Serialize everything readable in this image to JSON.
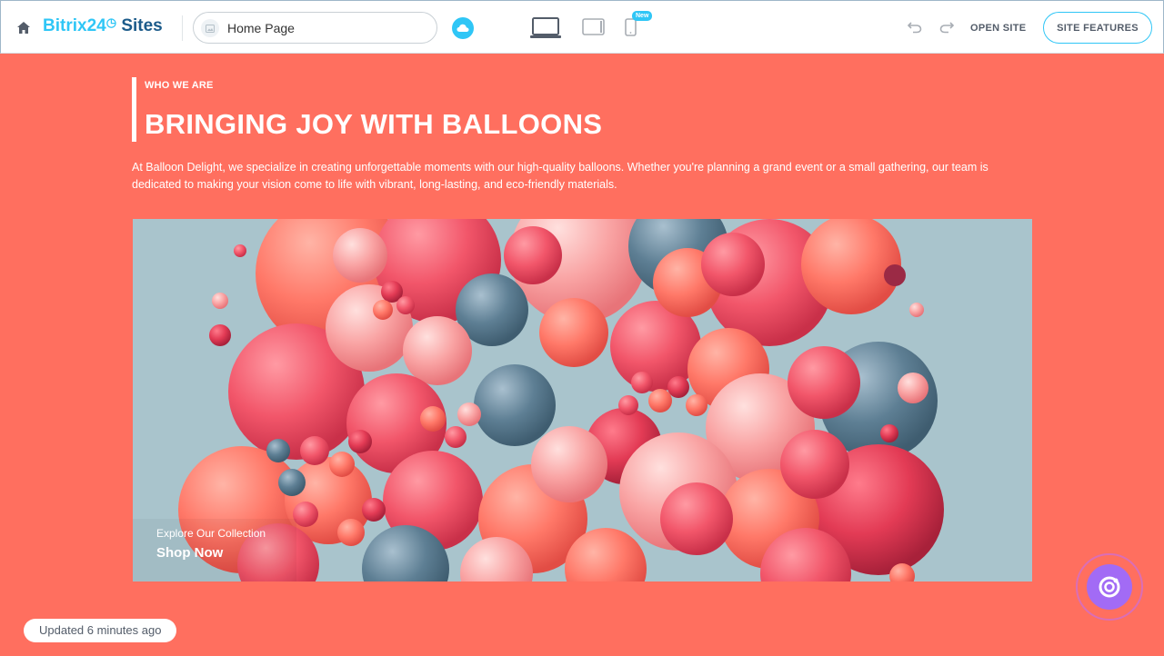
{
  "topbar": {
    "logo_brand": "Bitrix24",
    "logo_suffix": "Sites",
    "page_selector": "Home Page",
    "new_badge": "New",
    "open_site": "OPEN SITE",
    "site_features": "SITE FEATURES"
  },
  "content": {
    "eyebrow": "WHO WE ARE",
    "headline": "BRINGING JOY WITH BALLOONS",
    "description": "At Balloon Delight, we specialize in creating unforgettable moments with our high-quality balloons. Whether you're planning a grand event or a small gathering, our team is dedicated to making your vision come to life with vibrant, long-lasting, and eco-friendly materials.",
    "hero_caption": "Explore Our Collection",
    "hero_cta": "Shop Now"
  },
  "status": {
    "updated": "Updated 6 minutes ago"
  },
  "colors": {
    "page_background": "#ff6f5f",
    "brand_blue": "#2fc6f6",
    "brand_dark": "#1c5b8a",
    "hero_background": "#a9c4cc",
    "balloon_palette": [
      "#f2566a",
      "#ff7868",
      "#f98c8f",
      "#ffb0b0",
      "#e33b55",
      "#5e7f94",
      "#c93049"
    ],
    "assistant": "#a26bf5"
  },
  "icons": [
    "home-icon",
    "page-thumb-icon",
    "cloud-icon",
    "desktop-icon",
    "tablet-icon",
    "mobile-icon",
    "undo-icon",
    "redo-icon",
    "assistant-icon"
  ]
}
